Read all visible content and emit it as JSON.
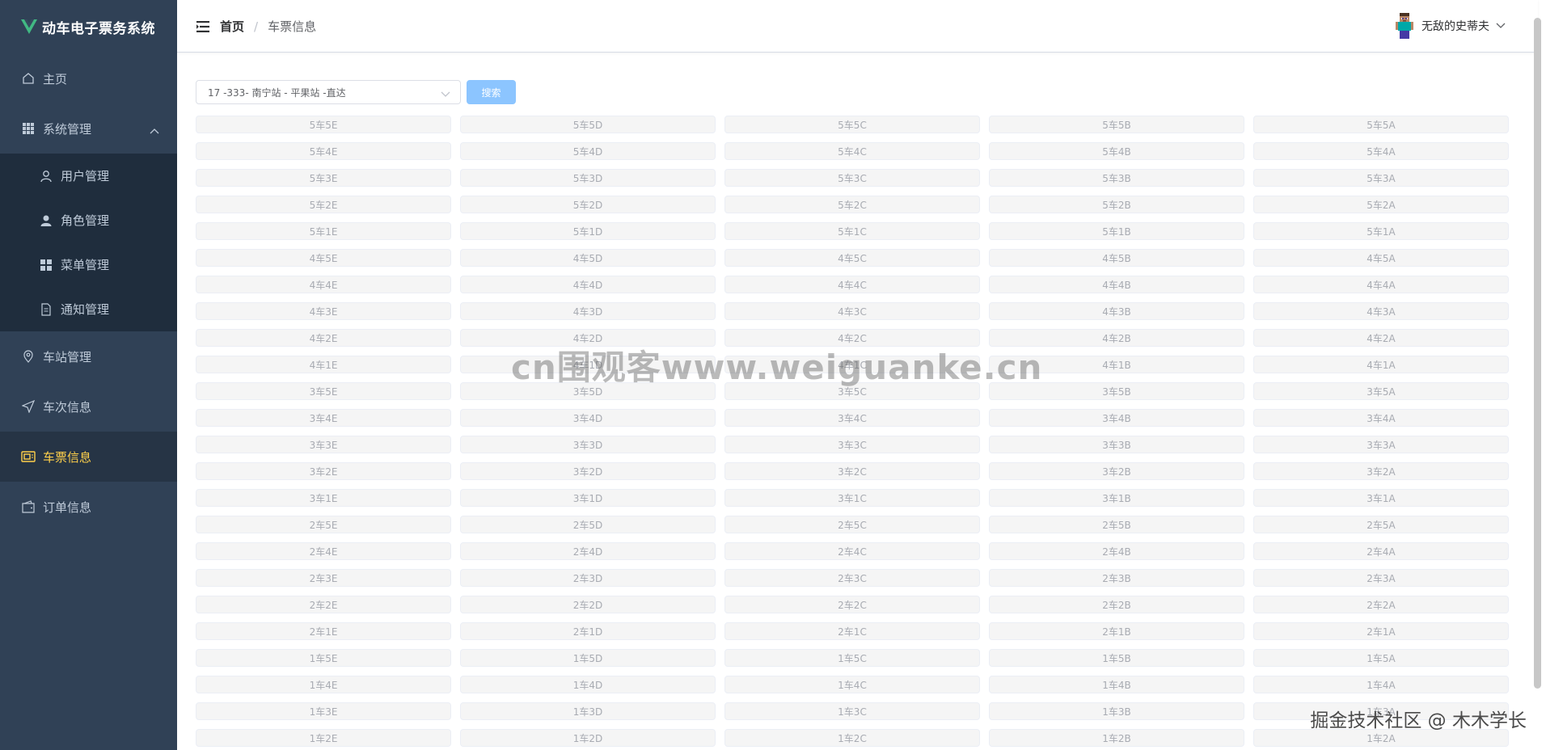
{
  "app": {
    "title": "动车电子票务系统",
    "logo_icon": "vue-logo-icon",
    "logo_colors": [
      "#41b883",
      "#35495e"
    ]
  },
  "sidebar": {
    "items": [
      {
        "label": "主页",
        "icon": "home-icon",
        "name": "sidebar-item-home",
        "level": 0
      },
      {
        "label": "系统管理",
        "icon": "grid-icon",
        "name": "sidebar-item-system",
        "level": 0,
        "expanded": true
      },
      {
        "label": "用户管理",
        "icon": "user-icon",
        "name": "sidebar-item-users",
        "level": 1
      },
      {
        "label": "角色管理",
        "icon": "person-icon",
        "name": "sidebar-item-roles",
        "level": 1
      },
      {
        "label": "菜单管理",
        "icon": "menu-grid-icon",
        "name": "sidebar-item-menus",
        "level": 1
      },
      {
        "label": "通知管理",
        "icon": "document-icon",
        "name": "sidebar-item-notices",
        "level": 1
      },
      {
        "label": "车站管理",
        "icon": "location-icon",
        "name": "sidebar-item-stations",
        "level": 0
      },
      {
        "label": "车次信息",
        "icon": "send-icon",
        "name": "sidebar-item-trains",
        "level": 0
      },
      {
        "label": "车票信息",
        "icon": "ticket-icon",
        "name": "sidebar-item-tickets",
        "level": 0,
        "active": true
      },
      {
        "label": "订单信息",
        "icon": "wallet-icon",
        "name": "sidebar-item-orders",
        "level": 0
      }
    ],
    "colors": {
      "bg": "#304156",
      "text": "#bfcbd9",
      "active": "#ffd04b"
    }
  },
  "header": {
    "breadcrumb": [
      "首页",
      "车票信息"
    ],
    "user_name": "无敌的史蒂夫",
    "avatar_icon": "steve-avatar-icon"
  },
  "search": {
    "select_value": "17 -333- 南宁站 - 平果站 -直达",
    "button_label": "搜索"
  },
  "seats": [
    [
      "5车5E",
      "5车5D",
      "5车5C",
      "5车5B",
      "5车5A"
    ],
    [
      "5车4E",
      "5车4D",
      "5车4C",
      "5车4B",
      "5车4A"
    ],
    [
      "5车3E",
      "5车3D",
      "5车3C",
      "5车3B",
      "5车3A"
    ],
    [
      "5车2E",
      "5车2D",
      "5车2C",
      "5车2B",
      "5车2A"
    ],
    [
      "5车1E",
      "5车1D",
      "5车1C",
      "5车1B",
      "5车1A"
    ],
    [
      "4车5E",
      "4车5D",
      "4车5C",
      "4车5B",
      "4车5A"
    ],
    [
      "4车4E",
      "4车4D",
      "4车4C",
      "4车4B",
      "4车4A"
    ],
    [
      "4车3E",
      "4车3D",
      "4车3C",
      "4车3B",
      "4车3A"
    ],
    [
      "4车2E",
      "4车2D",
      "4车2C",
      "4车2B",
      "4车2A"
    ],
    [
      "4车1E",
      "4车1D",
      "4车1C",
      "4车1B",
      "4车1A"
    ],
    [
      "3车5E",
      "3车5D",
      "3车5C",
      "3车5B",
      "3车5A"
    ],
    [
      "3车4E",
      "3车4D",
      "3车4C",
      "3车4B",
      "3车4A"
    ],
    [
      "3车3E",
      "3车3D",
      "3车3C",
      "3车3B",
      "3车3A"
    ],
    [
      "3车2E",
      "3车2D",
      "3车2C",
      "3车2B",
      "3车2A"
    ],
    [
      "3车1E",
      "3车1D",
      "3车1C",
      "3车1B",
      "3车1A"
    ],
    [
      "2车5E",
      "2车5D",
      "2车5C",
      "2车5B",
      "2车5A"
    ],
    [
      "2车4E",
      "2车4D",
      "2车4C",
      "2车4B",
      "2车4A"
    ],
    [
      "2车3E",
      "2车3D",
      "2车3C",
      "2车3B",
      "2车3A"
    ],
    [
      "2车2E",
      "2车2D",
      "2车2C",
      "2车2B",
      "2车2A"
    ],
    [
      "2车1E",
      "2车1D",
      "2车1C",
      "2车1B",
      "2车1A"
    ],
    [
      "1车5E",
      "1车5D",
      "1车5C",
      "1车5B",
      "1车5A"
    ],
    [
      "1车4E",
      "1车4D",
      "1车4C",
      "1车4B",
      "1车4A"
    ],
    [
      "1车3E",
      "1车3D",
      "1车3C",
      "1车3B",
      "1车3A"
    ],
    [
      "1车2E",
      "1车2D",
      "1车2C",
      "1车2B",
      "1车2A"
    ]
  ],
  "overlays": {
    "watermark": "cn围观客www.weiguanke.cn",
    "credit": "掘金技术社区 @ 木木学长"
  },
  "colors": {
    "primary_light": "#8cc5ff",
    "seat_bg": "#f5f5f5",
    "seat_text": "#a8abb2"
  }
}
